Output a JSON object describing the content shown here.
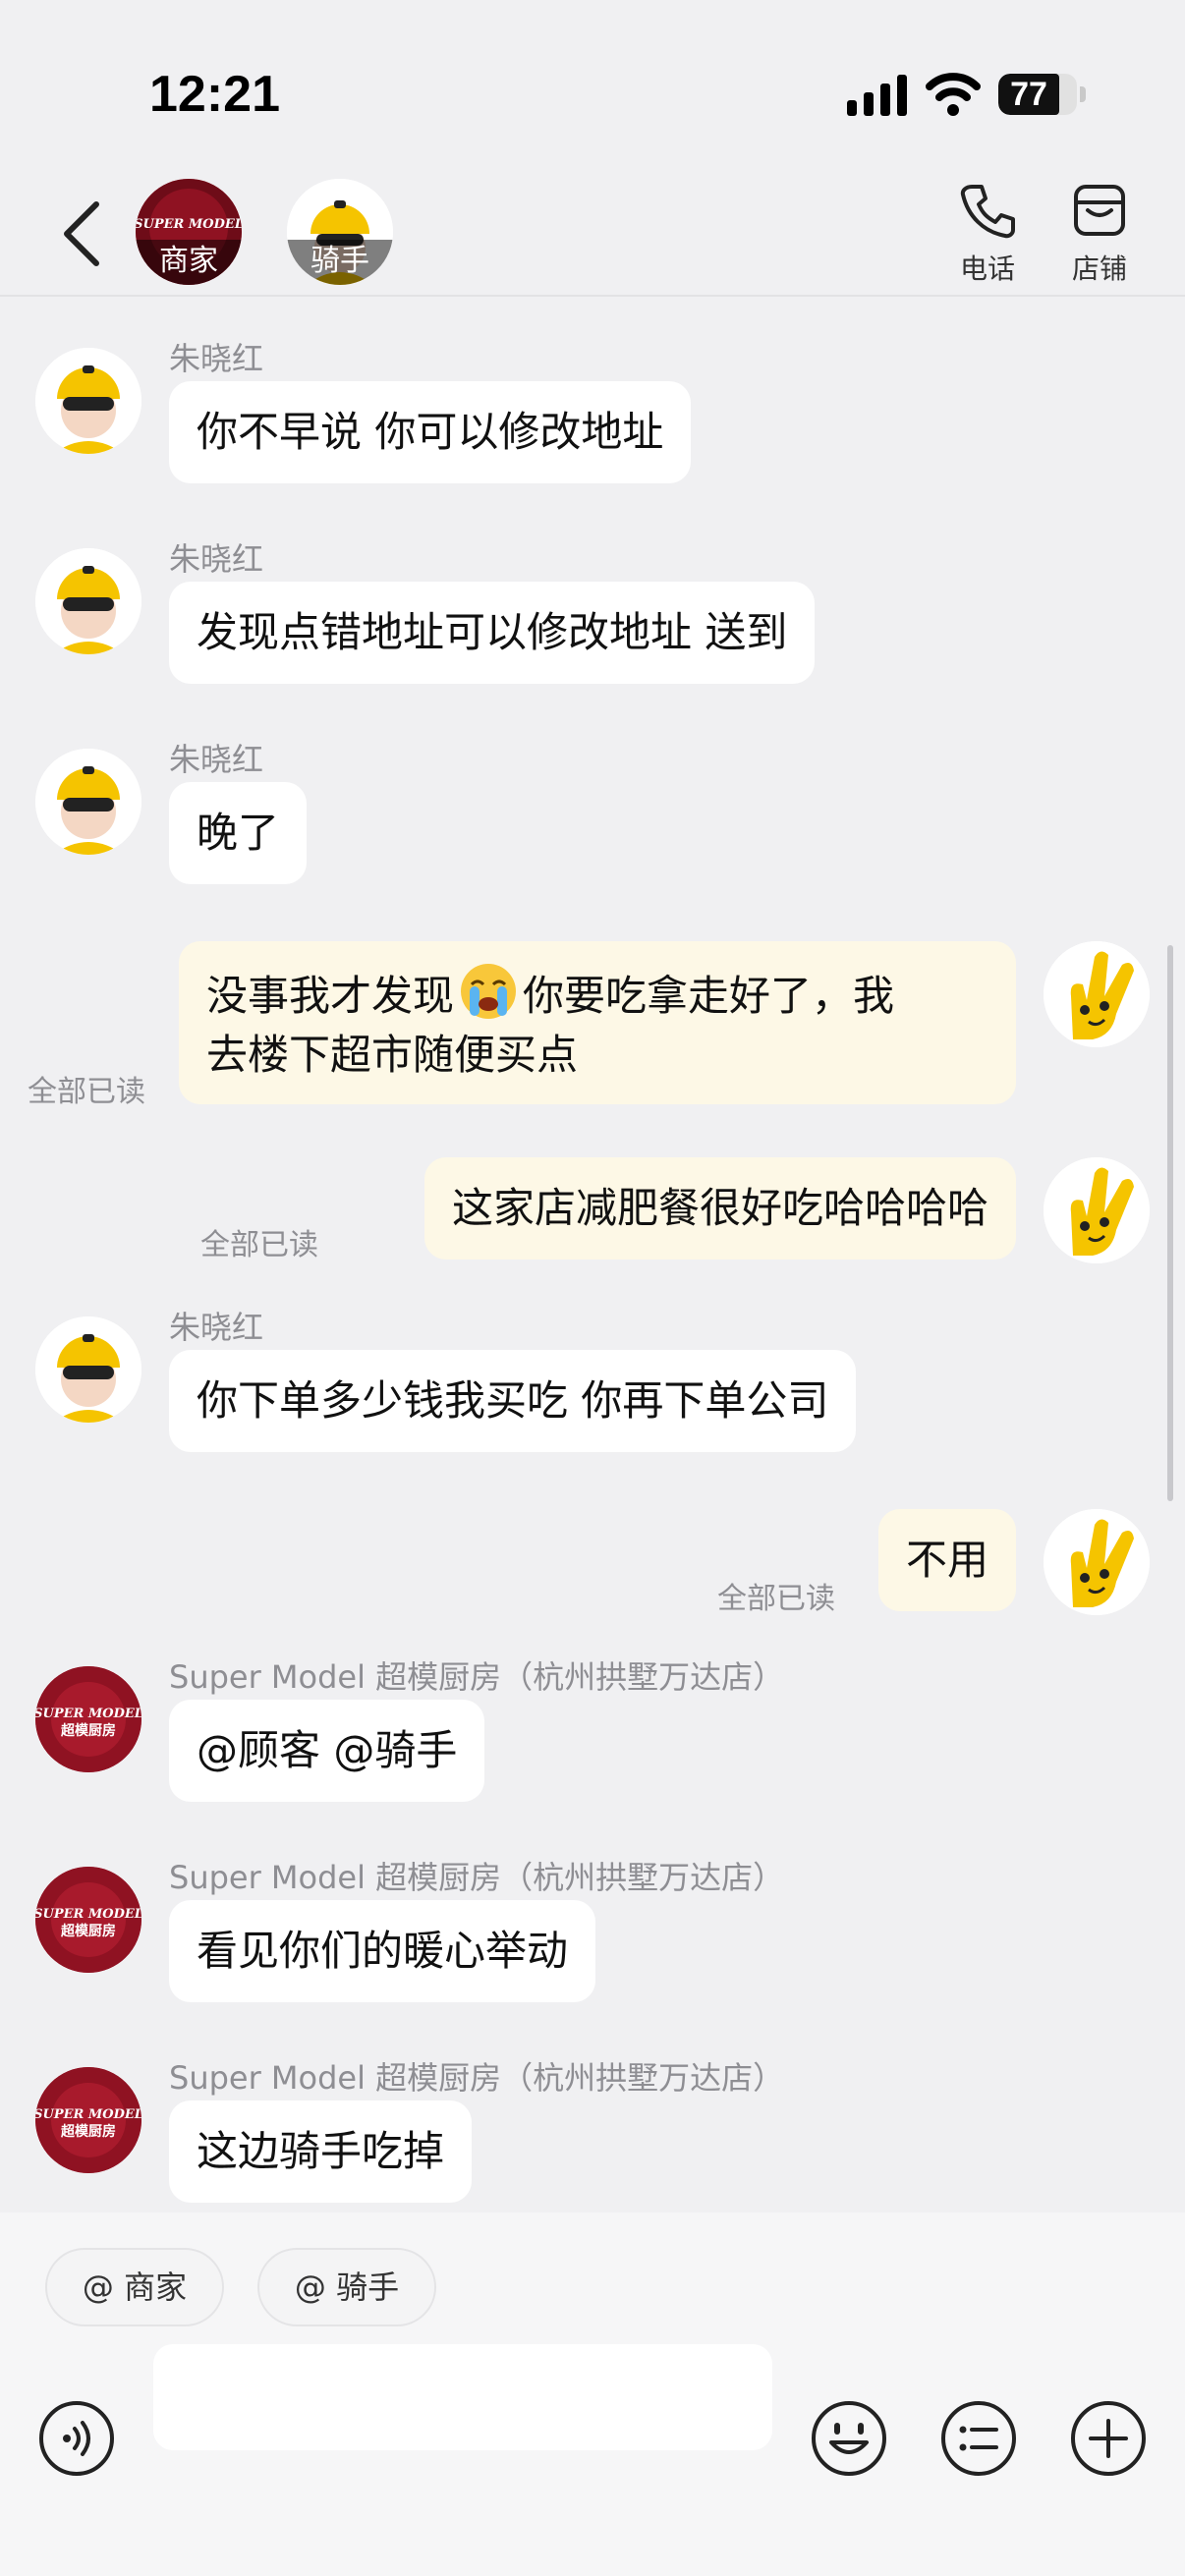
{
  "status_bar": {
    "time": "12:21",
    "battery": "77",
    "battery_level": 0.77
  },
  "header": {
    "merchant_label": "商家",
    "merchant_logo_text": "SUPER MODEL",
    "rider_label": "骑手",
    "phone_label": "电话",
    "store_label": "店铺"
  },
  "messages": [
    {
      "sender": "朱晓红",
      "text": "你不早说 你可以修改地址"
    },
    {
      "sender": "朱晓红",
      "text": "发现点错地址可以修改地址 送到"
    },
    {
      "sender": "朱晓红",
      "text": "晚了"
    },
    {
      "text_before_emoji": "没事我才发现",
      "emoji": "crying-face-emoji",
      "text_after_emoji": "你要吃拿走好了，我",
      "text_line2": "去楼下超市随便买点",
      "read": "全部已读"
    },
    {
      "text": "这家店减肥餐很好吃哈哈哈哈",
      "read": "全部已读"
    },
    {
      "sender": "朱晓红",
      "text": "你下单多少钱我买吃 你再下单公司"
    },
    {
      "text": "不用",
      "read": "全部已读"
    },
    {
      "sender": "Super Model 超模厨房（杭州拱墅万达店）",
      "text": "@顾客 @骑手"
    },
    {
      "sender": "Super Model 超模厨房（杭州拱墅万达店）",
      "text": "看见你们的暖心举动"
    },
    {
      "sender": "Super Model 超模厨房（杭州拱墅万达店）",
      "text": "这边骑手吃掉"
    }
  ],
  "merchant_avatar_text": {
    "line1": "SUPER MODEL",
    "line2": "超模厨房"
  },
  "input": {
    "mention_merchant": "@ 商家",
    "mention_rider": "@ 骑手",
    "placeholder": "",
    "value": ""
  },
  "colors": {
    "background": "#f0f0f2",
    "incoming_bubble": "#ffffff",
    "outgoing_bubble": "#fdf8e6",
    "rider_helmet": "#f5c400",
    "merchant_brand": "#a01024"
  }
}
